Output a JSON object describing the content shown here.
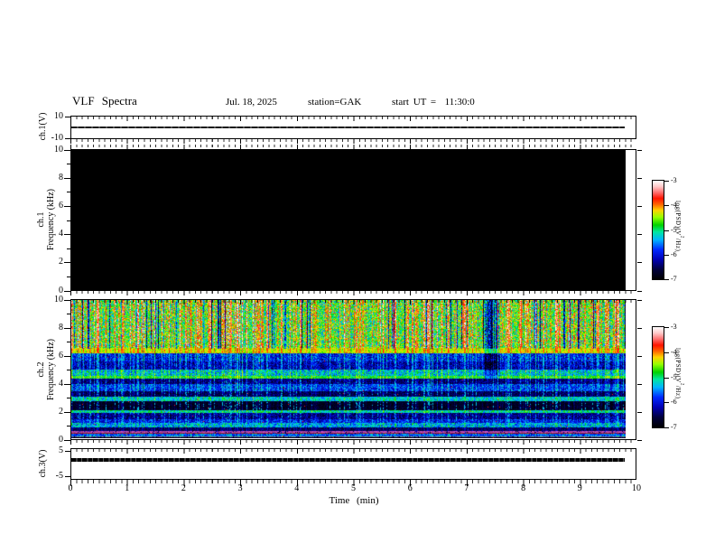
{
  "header": {
    "title": "VLF Spectra",
    "date": "Jul. 18, 2025",
    "station": "station=GAK",
    "start_ut": "start UT =  11:30:0"
  },
  "time_axis": {
    "label": "Time (min)",
    "ticks": [
      "0",
      "1",
      "2",
      "3",
      "4",
      "5",
      "6",
      "7",
      "8",
      "9",
      "10"
    ],
    "range": [
      0,
      10
    ]
  },
  "panels": {
    "ch1_voltage": {
      "ylabel": "ch.1(V)",
      "ytick_top": "10",
      "ytick_bottom": "-10",
      "ylim": [
        -10,
        10
      ]
    },
    "ch1_spectrogram": {
      "ylabel_line1": "ch.1",
      "ylabel_line2": "Frequency (kHz)",
      "yticks": [
        "0",
        "2",
        "4",
        "6",
        "8",
        "10"
      ],
      "ylim": [
        0,
        10
      ]
    },
    "ch2_spectrogram": {
      "ylabel_line1": "ch.2",
      "ylabel_line2": "Frequency (kHz)",
      "yticks": [
        "0",
        "2",
        "4",
        "6",
        "8",
        "10"
      ],
      "ylim": [
        0,
        10
      ]
    },
    "ch3_voltage": {
      "ylabel": "ch.3(V)",
      "ytick_top": "5",
      "ytick_bottom": "-5",
      "ylim": [
        -6,
        6
      ]
    }
  },
  "colorbar": {
    "label_pre": "log(PSD)(V",
    "label_sup": "2",
    "label_post": "/Hz)",
    "ticks": [
      "-3",
      "-4",
      "-5",
      "-6",
      "-7"
    ],
    "range": [
      -7,
      -3
    ],
    "gradient": [
      [
        0.0,
        "#000000"
      ],
      [
        0.1,
        "#00003c"
      ],
      [
        0.2,
        "#0000b4"
      ],
      [
        0.3,
        "#0028ff"
      ],
      [
        0.4,
        "#00b4ff"
      ],
      [
        0.48,
        "#00e6a0"
      ],
      [
        0.55,
        "#00d200"
      ],
      [
        0.63,
        "#96ff00"
      ],
      [
        0.7,
        "#ffd200"
      ],
      [
        0.76,
        "#ff6400"
      ],
      [
        0.82,
        "#ff1400"
      ],
      [
        0.88,
        "#ff6e6e"
      ],
      [
        0.94,
        "#ffc8c8"
      ],
      [
        1.0,
        "#ffffff"
      ]
    ]
  },
  "chart_data": [
    {
      "type": "line",
      "panel": "ch.1(V)",
      "ylim": [
        -10,
        10
      ],
      "x": [
        0,
        9.8
      ],
      "values": [
        0,
        0
      ],
      "note": "flat trace at ~0 V across full record"
    },
    {
      "type": "heatmap",
      "panel": "ch.1 spectrogram",
      "xlim": [
        0,
        10
      ],
      "ylim": [
        0,
        10
      ],
      "data_extent_min": 9.8,
      "colorbar_range": [
        -7,
        -3
      ],
      "uniform_level": -7,
      "note": "entire panel at/below -7 (black)"
    },
    {
      "type": "heatmap",
      "panel": "ch.2 spectrogram",
      "xlim": [
        0,
        10
      ],
      "ylim": [
        0,
        10
      ],
      "data_extent_min": 9.8,
      "colorbar_range": [
        -7,
        -3
      ],
      "bands": [
        {
          "f": [
            6.55,
            10.0
          ],
          "base": -5.0,
          "amp": 0.7,
          "streak": 1.0
        },
        {
          "f": [
            6.18,
            6.55
          ],
          "base": -4.55,
          "amp": 0.25,
          "streak": 0.5
        },
        {
          "f": [
            5.55,
            6.18
          ],
          "base": -6.1,
          "amp": 0.5,
          "streak": 0.55
        },
        {
          "f": [
            4.95,
            5.55
          ],
          "base": -6.35,
          "amp": 0.45,
          "streak": 0.5
        },
        {
          "f": [
            4.52,
            4.95
          ],
          "base": -5.45,
          "amp": 0.5,
          "streak": 0.45
        },
        {
          "f": [
            4.32,
            4.52
          ],
          "base": -5.0,
          "amp": 0.3,
          "streak": 0.4
        },
        {
          "f": [
            3.92,
            4.32
          ],
          "base": -6.55,
          "amp": 0.35,
          "streak": 0.4
        },
        {
          "f": [
            3.42,
            3.92
          ],
          "base": -5.95,
          "amp": 0.5,
          "streak": 0.4
        },
        {
          "f": [
            2.98,
            3.42
          ],
          "base": -6.65,
          "amp": 0.3,
          "streak": 0.35
        },
        {
          "f": [
            2.68,
            2.98
          ],
          "base": -5.4,
          "amp": 0.4,
          "streak": 0.35
        },
        {
          "f": [
            2.02,
            2.68
          ],
          "base": -6.85,
          "amp": 0.2,
          "streak": 0.3
        },
        {
          "f": [
            1.78,
            2.02
          ],
          "base": -5.25,
          "amp": 0.4,
          "streak": 0.3
        },
        {
          "f": [
            1.32,
            1.78
          ],
          "base": -6.45,
          "amp": 0.4,
          "streak": 0.3
        },
        {
          "f": [
            1.06,
            1.32
          ],
          "base": -6.05,
          "amp": 0.45,
          "streak": 0.3
        },
        {
          "f": [
            0.78,
            1.06
          ],
          "base": -5.55,
          "amp": 0.5,
          "streak": 0.3
        },
        {
          "f": [
            0.5,
            0.78
          ],
          "base": -6.6,
          "amp": 0.3,
          "streak": 0.25
        },
        {
          "f": [
            0.3,
            0.5
          ],
          "base": -6.5,
          "amp": 0.3,
          "streak": 0.25
        },
        {
          "f": [
            0.1,
            0.3
          ],
          "base": -5.8,
          "amp": 0.5,
          "streak": 0.25
        },
        {
          "f": [
            0.0,
            0.1
          ],
          "base": -6.8,
          "amp": 0.2,
          "streak": 0.2
        }
      ],
      "lines": [
        {
          "f": 0.42,
          "color": "#c050c0"
        },
        {
          "f": 0.33,
          "color": "#b02020"
        },
        {
          "f": 0.05,
          "color": "#808080"
        }
      ],
      "anomaly": {
        "t": [
          7.3,
          7.55
        ],
        "darken": 1.6
      }
    },
    {
      "type": "line",
      "panel": "ch.3(V)",
      "ylim": [
        -6,
        6
      ],
      "x": [
        0,
        9.8
      ],
      "values": [
        1,
        1
      ],
      "note": "flat thick trace near 0-1 V across full record"
    }
  ]
}
